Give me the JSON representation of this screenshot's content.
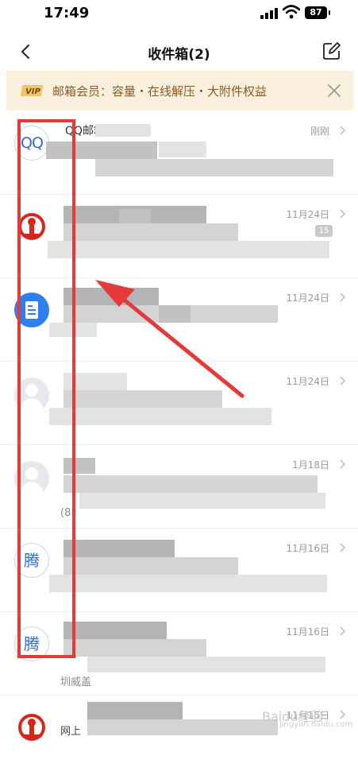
{
  "status_bar": {
    "time": "17:49",
    "battery": "87"
  },
  "nav": {
    "title": "收件箱(2)"
  },
  "vip_banner": {
    "badge": "VIP",
    "text": "邮箱会员：容量・在线解压・大附件权益"
  },
  "mail_items": [
    {
      "sender_fragment": "QQ邮箱",
      "time": "刚刚",
      "avatar_text": "QQ"
    },
    {
      "time": "11月24日",
      "badge": "15"
    },
    {
      "time": "11月24日"
    },
    {
      "time": "11月24日"
    },
    {
      "time": "1月18日",
      "preview_fragment": "(8"
    },
    {
      "time": "11月16日",
      "avatar_text": "腾"
    },
    {
      "time": "11月16日",
      "avatar_text": "腾",
      "preview_fragment": "圳威盖"
    },
    {
      "time": "11月15日",
      "preview_fragment": "网上"
    }
  ],
  "watermark": {
    "text": "Baidu经验",
    "sub": "jingyan.baidu.com"
  },
  "icons": {
    "back": "chevron-left-icon",
    "compose": "compose-icon",
    "close": "close-icon",
    "chevron": "chevron-right-icon",
    "railway": "railway-logo-icon",
    "doc": "document-icon",
    "person": "person-placeholder-icon"
  },
  "colors": {
    "accent": "#2f6bd8",
    "banner_bg": "#fbf0de",
    "banner_text": "#8a5a22",
    "annotation": "#e63a3a",
    "rail_red": "#d8261c"
  }
}
